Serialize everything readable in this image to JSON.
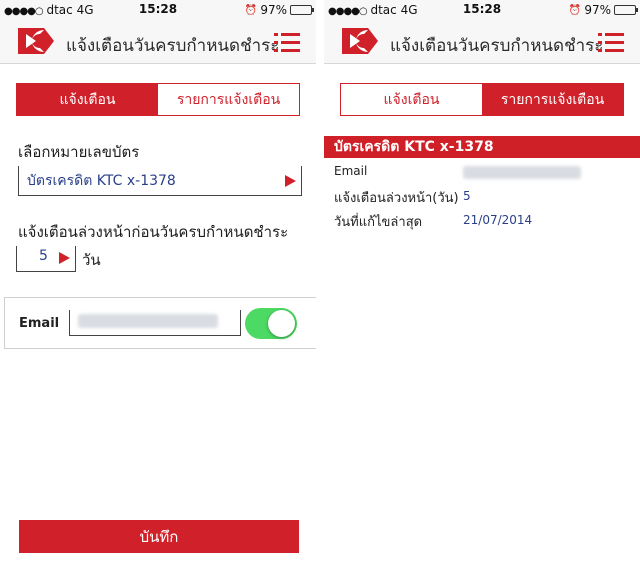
{
  "status_bar": {
    "carrier": "dtac",
    "network": "4G",
    "time": "15:28",
    "battery": "97%",
    "battery_level": 0.97
  },
  "header": {
    "title": "แจ้งเตือนวันครบกำหนดชำระ",
    "logo_icon": "ktc-logo",
    "menu_icon": "hamburger-menu-icon"
  },
  "tabs": [
    {
      "label": "แจ้งเตือน"
    },
    {
      "label": "รายการแจ้งเตือน"
    }
  ],
  "left_screen": {
    "active_tab": 0,
    "card_label": "เลือกหมายเลขบัตร",
    "card_value": "บัตรเครดิต KTC x-1378",
    "advance_label": "แจ้งเตือนล่วงหน้าก่อนวันครบกำหนดชำระ",
    "days_value": "5",
    "days_unit": "วัน",
    "email_label": "Email",
    "email_toggle_on": true,
    "save_label": "บันทึก"
  },
  "right_screen": {
    "active_tab": 1,
    "section_title": "บัตรเครดิต KTC x-1378",
    "rows": [
      {
        "label": "Email",
        "value": ""
      },
      {
        "label": "แจ้งเตือนล่วงหน้า(วัน)",
        "value": "5"
      },
      {
        "label": "วันที่แก้ไขล่าสุด",
        "value": "21/07/2014"
      }
    ]
  },
  "colors": {
    "brand_red": "#d0202a",
    "value_blue": "#2a3f8a",
    "toggle_green": "#4cd964"
  }
}
